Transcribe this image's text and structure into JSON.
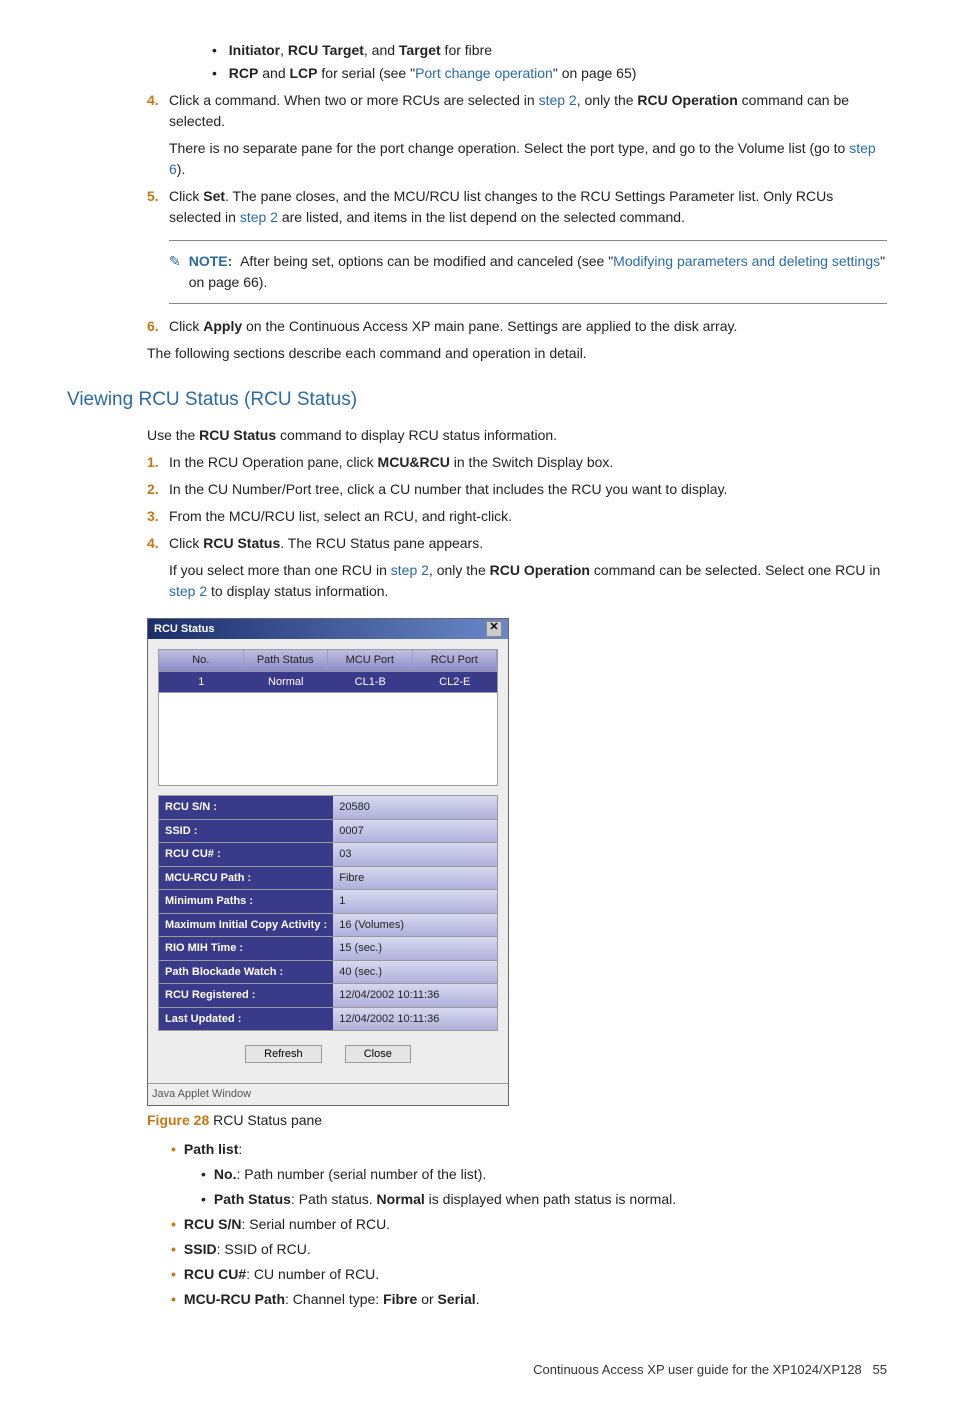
{
  "bullets": {
    "fibre_pre": "Initiator",
    "fibre_mid": "RCU Target",
    "fibre_and": ", and ",
    "fibre_end": "Target",
    "fibre_tail": " for fibre",
    "serial_a": "RCP",
    "serial_b": "LCP",
    "serial_mid": " and ",
    "serial_post": " for serial (see \"",
    "serial_link": "Port change operation",
    "serial_tail": "\" on page 65)"
  },
  "step4a": "Click a command. When two or more RCUs are selected in ",
  "step4link": "step 2",
  "step4b": ", only the ",
  "step4bold": "RCU Operation",
  "step4c": " command can be selected.",
  "step4extra_a": "There is no separate pane for the port change operation. Select the port type, and go to the Volume list (go to ",
  "step4extra_link": "step 6",
  "step4extra_b": ").",
  "step5a": "Click ",
  "step5bold": "Set",
  "step5b": ". The pane closes, and the MCU/RCU list changes to the RCU Settings Parameter list. Only RCUs selected in ",
  "step5link": "step 2",
  "step5c": " are listed, and items in the list depend on the selected command.",
  "note_label": "NOTE:",
  "note_a": "After being set, options can be modified and canceled (see \"",
  "note_link": "Modifying parameters and deleting settings",
  "note_b": "\" on page 66).",
  "step6a": "Click ",
  "step6bold": "Apply",
  "step6b": " on the Continuous Access XP main pane. Settings are applied to the disk array.",
  "following": "The following sections describe each command and operation in detail.",
  "heading": "Viewing RCU Status (RCU Status)",
  "use_a": "Use the ",
  "use_bold": "RCU Status",
  "use_b": " command to display RCU status information.",
  "v1a": "In the RCU Operation pane, click ",
  "v1bold": "MCU&RCU",
  "v1b": " in the Switch Display box.",
  "v2": "In the CU Number/Port tree, click a CU number that includes the RCU you want to display.",
  "v3": "From the MCU/RCU list, select an RCU, and right-click.",
  "v4a": "Click ",
  "v4bold": "RCU Status",
  "v4b": ". The RCU Status pane appears.",
  "v4extra_a": "If you select more than one RCU in ",
  "v4link1": "step 2",
  "v4extra_b": ", only the ",
  "v4extra_bold": "RCU Operation",
  "v4extra_c": " command can be selected. Select one RCU in ",
  "v4link2": "step 2",
  "v4extra_d": " to display status information.",
  "panel": {
    "title": "RCU Status",
    "headers": {
      "no": "No.",
      "ps": "Path Status",
      "mcu": "MCU Port",
      "rcu": "RCU Port"
    },
    "row": {
      "no": "1",
      "ps": "Normal",
      "mcu": "CL1-B",
      "rcu": "CL2-E"
    },
    "pairs": [
      {
        "k": "RCU S/N :",
        "v": "20580"
      },
      {
        "k": "SSID :",
        "v": "0007"
      },
      {
        "k": "RCU CU# :",
        "v": "03"
      },
      {
        "k": "MCU-RCU Path :",
        "v": "Fibre"
      },
      {
        "k": "Minimum Paths :",
        "v": "1"
      },
      {
        "k": "Maximum Initial Copy Activity :",
        "v": "16 (Volumes)"
      },
      {
        "k": "RIO MIH Time :",
        "v": "15 (sec.)"
      },
      {
        "k": "Path Blockade Watch :",
        "v": "40 (sec.)"
      },
      {
        "k": "RCU Registered :",
        "v": "12/04/2002 10:11:36"
      },
      {
        "k": "Last Updated :",
        "v": "12/04/2002 10:11:36"
      }
    ],
    "refresh": "Refresh",
    "close": "Close",
    "applet": "Java Applet Window"
  },
  "figcap_a": "Figure 28",
  "figcap_b": " RCU Status pane",
  "defs": {
    "pathlist": "Path list",
    "no_a": "No.",
    "no_b": ": Path number (serial number of the list).",
    "ps_a": "Path Status",
    "ps_b": ": Path status. ",
    "ps_c": "Normal",
    "ps_d": " is displayed when path status is normal.",
    "sn_a": "RCU S/N",
    "sn_b": ": Serial number of RCU.",
    "ssid_a": "SSID",
    "ssid_b": ": SSID of RCU.",
    "cu_a": "RCU CU#",
    "cu_b": ": CU number of RCU.",
    "path_a": "MCU-RCU Path",
    "path_b": ": Channel type: ",
    "path_c": "Fibre",
    "path_d": " or ",
    "path_e": "Serial",
    "path_f": "."
  },
  "footer_a": "Continuous Access XP user guide for the XP1024/XP128",
  "footer_pg": "55"
}
